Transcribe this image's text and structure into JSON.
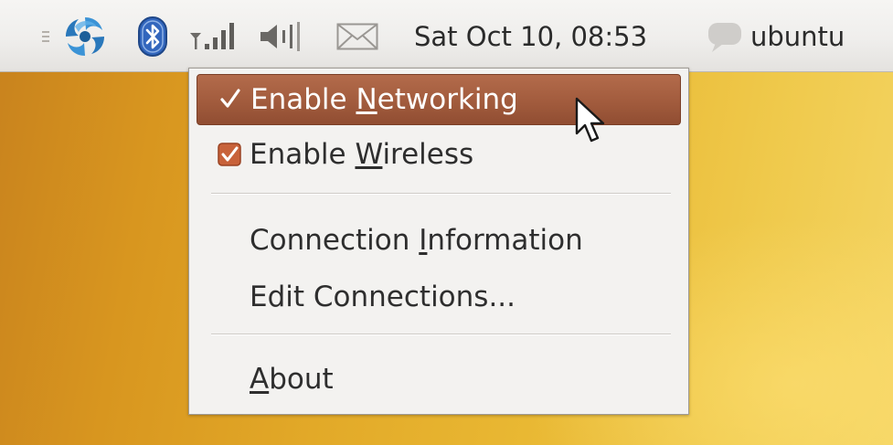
{
  "panel": {
    "clock_text": "Sat Oct 10, 08:53",
    "user_name": "ubuntu",
    "indicators": [
      {
        "icon": "network-manager-swirl-icon"
      },
      {
        "icon": "bluetooth-icon"
      },
      {
        "icon": "signal-strength-icon"
      },
      {
        "icon": "volume-icon"
      },
      {
        "icon": "mail-envelope-icon"
      },
      {
        "icon": "chat-bubble-icon"
      }
    ]
  },
  "menu": {
    "items": [
      {
        "pre": "Enable ",
        "mn": "N",
        "post": "etworking",
        "checked": true,
        "selected": true
      },
      {
        "pre": "Enable ",
        "mn": "W",
        "post": "ireless",
        "checked": true,
        "selected": false
      },
      {
        "pre": "Connection ",
        "mn": "I",
        "post": "nformation",
        "checked": false,
        "selected": false
      },
      {
        "pre": "Edit Connections...",
        "mn": "",
        "post": "",
        "checked": false,
        "selected": false
      },
      {
        "pre": "",
        "mn": "A",
        "post": "bout",
        "checked": false,
        "selected": false
      }
    ]
  },
  "colors": {
    "highlight": "#a05a3c",
    "checkbox": "#c8623a",
    "panel_bg": "#efeeec",
    "menu_bg": "#f3f2f0",
    "bluetooth": "#2f63b8",
    "swirl": "#2d7fc1"
  }
}
